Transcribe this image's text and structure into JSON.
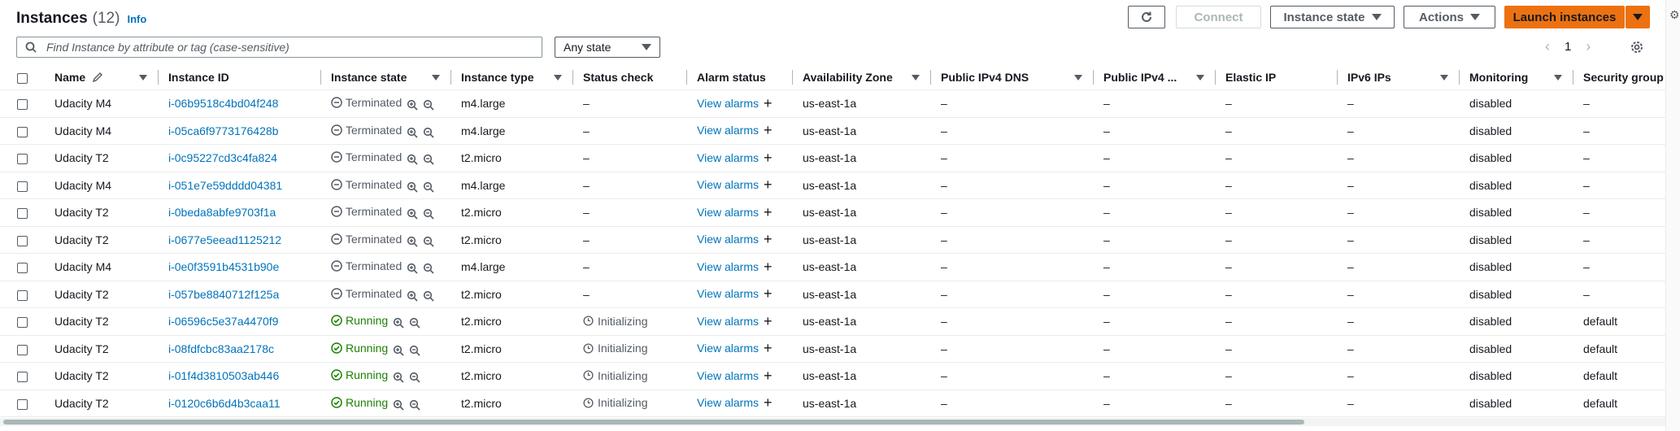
{
  "header": {
    "title": "Instances",
    "count": "(12)",
    "info": "Info"
  },
  "toolbar": {
    "connect": "Connect",
    "instance_state": "Instance state",
    "actions": "Actions",
    "launch": "Launch instances"
  },
  "filter": {
    "search_placeholder": "Find Instance by attribute or tag (case-sensitive)",
    "state_select": "Any state"
  },
  "pagination": {
    "page": "1"
  },
  "columns": {
    "name": "Name",
    "instance_id": "Instance ID",
    "instance_state": "Instance state",
    "instance_type": "Instance type",
    "status_check": "Status check",
    "alarm_status": "Alarm status",
    "az": "Availability Zone",
    "dns": "Public IPv4 DNS",
    "ipv4": "Public IPv4 ...",
    "eip": "Elastic IP",
    "ipv6": "IPv6 IPs",
    "monitoring": "Monitoring",
    "sg": "Security group name"
  },
  "rows": [
    {
      "name": "Udacity M4",
      "id": "i-06b9518c4bd04f248",
      "state": "Terminated",
      "type": "m4.large",
      "status": "–",
      "alarm": "View alarms",
      "az": "us-east-1a",
      "dns": "–",
      "ipv4": "–",
      "eip": "–",
      "ipv6": "–",
      "monitoring": "disabled",
      "sg": "–"
    },
    {
      "name": "Udacity M4",
      "id": "i-05ca6f9773176428b",
      "state": "Terminated",
      "type": "m4.large",
      "status": "–",
      "alarm": "View alarms",
      "az": "us-east-1a",
      "dns": "–",
      "ipv4": "–",
      "eip": "–",
      "ipv6": "–",
      "monitoring": "disabled",
      "sg": "–"
    },
    {
      "name": "Udacity T2",
      "id": "i-0c95227cd3c4fa824",
      "state": "Terminated",
      "type": "t2.micro",
      "status": "–",
      "alarm": "View alarms",
      "az": "us-east-1a",
      "dns": "–",
      "ipv4": "–",
      "eip": "–",
      "ipv6": "–",
      "monitoring": "disabled",
      "sg": "–"
    },
    {
      "name": "Udacity M4",
      "id": "i-051e7e59dddd04381",
      "state": "Terminated",
      "type": "m4.large",
      "status": "–",
      "alarm": "View alarms",
      "az": "us-east-1a",
      "dns": "–",
      "ipv4": "–",
      "eip": "–",
      "ipv6": "–",
      "monitoring": "disabled",
      "sg": "–"
    },
    {
      "name": "Udacity T2",
      "id": "i-0beda8abfe9703f1a",
      "state": "Terminated",
      "type": "t2.micro",
      "status": "–",
      "alarm": "View alarms",
      "az": "us-east-1a",
      "dns": "–",
      "ipv4": "–",
      "eip": "–",
      "ipv6": "–",
      "monitoring": "disabled",
      "sg": "–"
    },
    {
      "name": "Udacity T2",
      "id": "i-0677e5eead1125212",
      "state": "Terminated",
      "type": "t2.micro",
      "status": "–",
      "alarm": "View alarms",
      "az": "us-east-1a",
      "dns": "–",
      "ipv4": "–",
      "eip": "–",
      "ipv6": "–",
      "monitoring": "disabled",
      "sg": "–"
    },
    {
      "name": "Udacity M4",
      "id": "i-0e0f3591b4531b90e",
      "state": "Terminated",
      "type": "m4.large",
      "status": "–",
      "alarm": "View alarms",
      "az": "us-east-1a",
      "dns": "–",
      "ipv4": "–",
      "eip": "–",
      "ipv6": "–",
      "monitoring": "disabled",
      "sg": "–"
    },
    {
      "name": "Udacity T2",
      "id": "i-057be8840712f125a",
      "state": "Terminated",
      "type": "t2.micro",
      "status": "–",
      "alarm": "View alarms",
      "az": "us-east-1a",
      "dns": "–",
      "ipv4": "–",
      "eip": "–",
      "ipv6": "–",
      "monitoring": "disabled",
      "sg": "–"
    },
    {
      "name": "Udacity T2",
      "id": "i-06596c5e37a4470f9",
      "state": "Running",
      "type": "t2.micro",
      "status": "Initializing",
      "alarm": "View alarms",
      "az": "us-east-1a",
      "dns": "–",
      "ipv4": "–",
      "eip": "–",
      "ipv6": "–",
      "monitoring": "disabled",
      "sg": "default"
    },
    {
      "name": "Udacity T2",
      "id": "i-08fdfcbc83aa2178c",
      "state": "Running",
      "type": "t2.micro",
      "status": "Initializing",
      "alarm": "View alarms",
      "az": "us-east-1a",
      "dns": "–",
      "ipv4": "–",
      "eip": "–",
      "ipv6": "–",
      "monitoring": "disabled",
      "sg": "default"
    },
    {
      "name": "Udacity T2",
      "id": "i-01f4d3810503ab446",
      "state": "Running",
      "type": "t2.micro",
      "status": "Initializing",
      "alarm": "View alarms",
      "az": "us-east-1a",
      "dns": "–",
      "ipv4": "–",
      "eip": "–",
      "ipv6": "–",
      "monitoring": "disabled",
      "sg": "default"
    },
    {
      "name": "Udacity T2",
      "id": "i-0120c6b6d4b3caa11",
      "state": "Running",
      "type": "t2.micro",
      "status": "Initializing",
      "alarm": "View alarms",
      "az": "us-east-1a",
      "dns": "–",
      "ipv4": "–",
      "eip": "–",
      "ipv6": "–",
      "monitoring": "disabled",
      "sg": "default"
    }
  ],
  "colors": {
    "link": "#0073bb",
    "running": "#1d8102",
    "primary": "#ec7211",
    "muted": "#545b64"
  },
  "icons": [
    "refresh-icon",
    "caret-down-icon",
    "search-icon",
    "settings-gear-icon",
    "edit-pencil-icon",
    "terminated-icon",
    "running-check-icon",
    "zoom-in-icon",
    "zoom-out-icon",
    "initializing-clock-icon",
    "plus-icon"
  ]
}
